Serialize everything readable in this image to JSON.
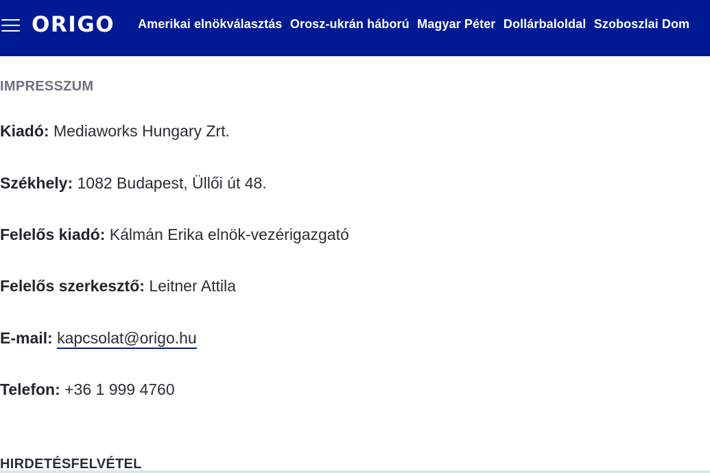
{
  "header": {
    "logo": "ORIGO",
    "nav": [
      "Amerikai elnökválasztás",
      "Orosz-ukrán háború",
      "Magyar Péter",
      "Dollárbaloldal",
      "Szoboszlai Dom"
    ],
    "colors": {
      "background": "#001a94",
      "text": "#ffffff"
    }
  },
  "impresszum": {
    "heading": "IMPRESSZUM",
    "rows": [
      {
        "label": "Kiadó:",
        "value": "Mediaworks Hungary Zrt."
      },
      {
        "label": "Székhely:",
        "value": "1082 Budapest, Üllői út 48."
      },
      {
        "label": "Felelős kiadó:",
        "value": "Kálmán Erika elnök-vezérigazgató"
      },
      {
        "label": "Felelős szerkesztő:",
        "value": "Leitner Attila"
      },
      {
        "label": "E-mail:",
        "value": "kapcsolat@origo.hu"
      },
      {
        "label": "Telefon:",
        "value": "+36 1 999 4760"
      }
    ]
  },
  "next_section": {
    "heading": "HIRDETÉSFELVÉTEL"
  }
}
